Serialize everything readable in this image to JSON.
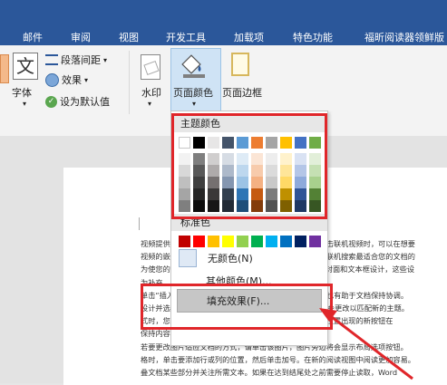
{
  "tabs": [
    "邮件",
    "审阅",
    "视图",
    "开发工具",
    "加载项",
    "特色功能",
    "福昕阅读器领鲜版"
  ],
  "ribbon": {
    "font_label": "字体",
    "paragraph_spacing": "段落间距",
    "effects": "效果",
    "set_default": "设为默认值",
    "watermark": "水印",
    "page_color": "页面颜色",
    "page_border": "页面边框"
  },
  "menu": {
    "theme_colors_header": "主题颜色",
    "standard_colors_header": "标准色",
    "no_color": "无颜色(N)",
    "more_colors": "其他颜色(M)...",
    "fill_effects": "填充效果(F)..."
  },
  "colors": {
    "theme_top": [
      "#ffffff",
      "#000000",
      "#e7e6e6",
      "#44546a",
      "#5b9bd5",
      "#ed7d31",
      "#a5a5a5",
      "#ffc000",
      "#4472c4",
      "#70ad47"
    ],
    "theme_shades": [
      [
        "#f2f2f2",
        "#7f7f7f",
        "#d0cece",
        "#d6dce4",
        "#deebf6",
        "#fbe5d5",
        "#ededed",
        "#fff2cc",
        "#d9e2f3",
        "#e2efd9"
      ],
      [
        "#d8d8d8",
        "#595959",
        "#aeaaaa",
        "#adb9ca",
        "#bdd7ee",
        "#f7cbac",
        "#dbdbdb",
        "#fee599",
        "#b4c6e7",
        "#c5e0b3"
      ],
      [
        "#bfbfbf",
        "#3f3f3f",
        "#757070",
        "#8496b0",
        "#9cc3e5",
        "#f4b183",
        "#c9c9c9",
        "#ffd966",
        "#8eaadb",
        "#a8d08d"
      ],
      [
        "#a5a5a5",
        "#262626",
        "#3a3838",
        "#323f4f",
        "#2e75b5",
        "#c55a11",
        "#7b7b7b",
        "#bf9000",
        "#2f5496",
        "#538135"
      ],
      [
        "#7f7f7f",
        "#0c0c0c",
        "#171616",
        "#222a35",
        "#1e4e79",
        "#833c0b",
        "#525252",
        "#7f6000",
        "#1f3864",
        "#375623"
      ]
    ],
    "standard": [
      "#c00000",
      "#ff0000",
      "#ffc000",
      "#ffff00",
      "#92d050",
      "#00b050",
      "#00b0f0",
      "#0070c0",
      "#002060",
      "#7030a0"
    ],
    "highlight_red": "#e0262a"
  },
  "document_lines": [
    "视频提供了功能强大的方法帮助您证明您的观点。当您单击联机视频时，可以在想要",
    "视频的嵌入代码中进行粘贴。您也可以键入一个关键字以联机搜索最适合您的文档的",
    "为使您的文档具有专业外观，Word 提供了页眉、页脚、封面和文本框设计，这些设",
    "为补充。",
    "单击“插入”，然后从不同库中选择所需元素。主题和样式也有助于文档保持协调。",
    "设计并选择新的主题时，图片、图表或 SmartArt 图形将会更改以匹配新的主题。",
    "式时，您的标题会进行更改以匹配新的主题。使用在需要位置出现的新按钮在",
    "保持内容。",
    "若要更改图片适应文档的方式，请单击该图片，图片旁边将会显示布局选项按钮。",
    "格时，单击要添加行或列的位置，然后单击加号。在新的阅读视图中阅读更加容易。",
    "叠文档某些部分并关注所需文本。如果在达到结尾处之前需要停止读取，Word"
  ]
}
